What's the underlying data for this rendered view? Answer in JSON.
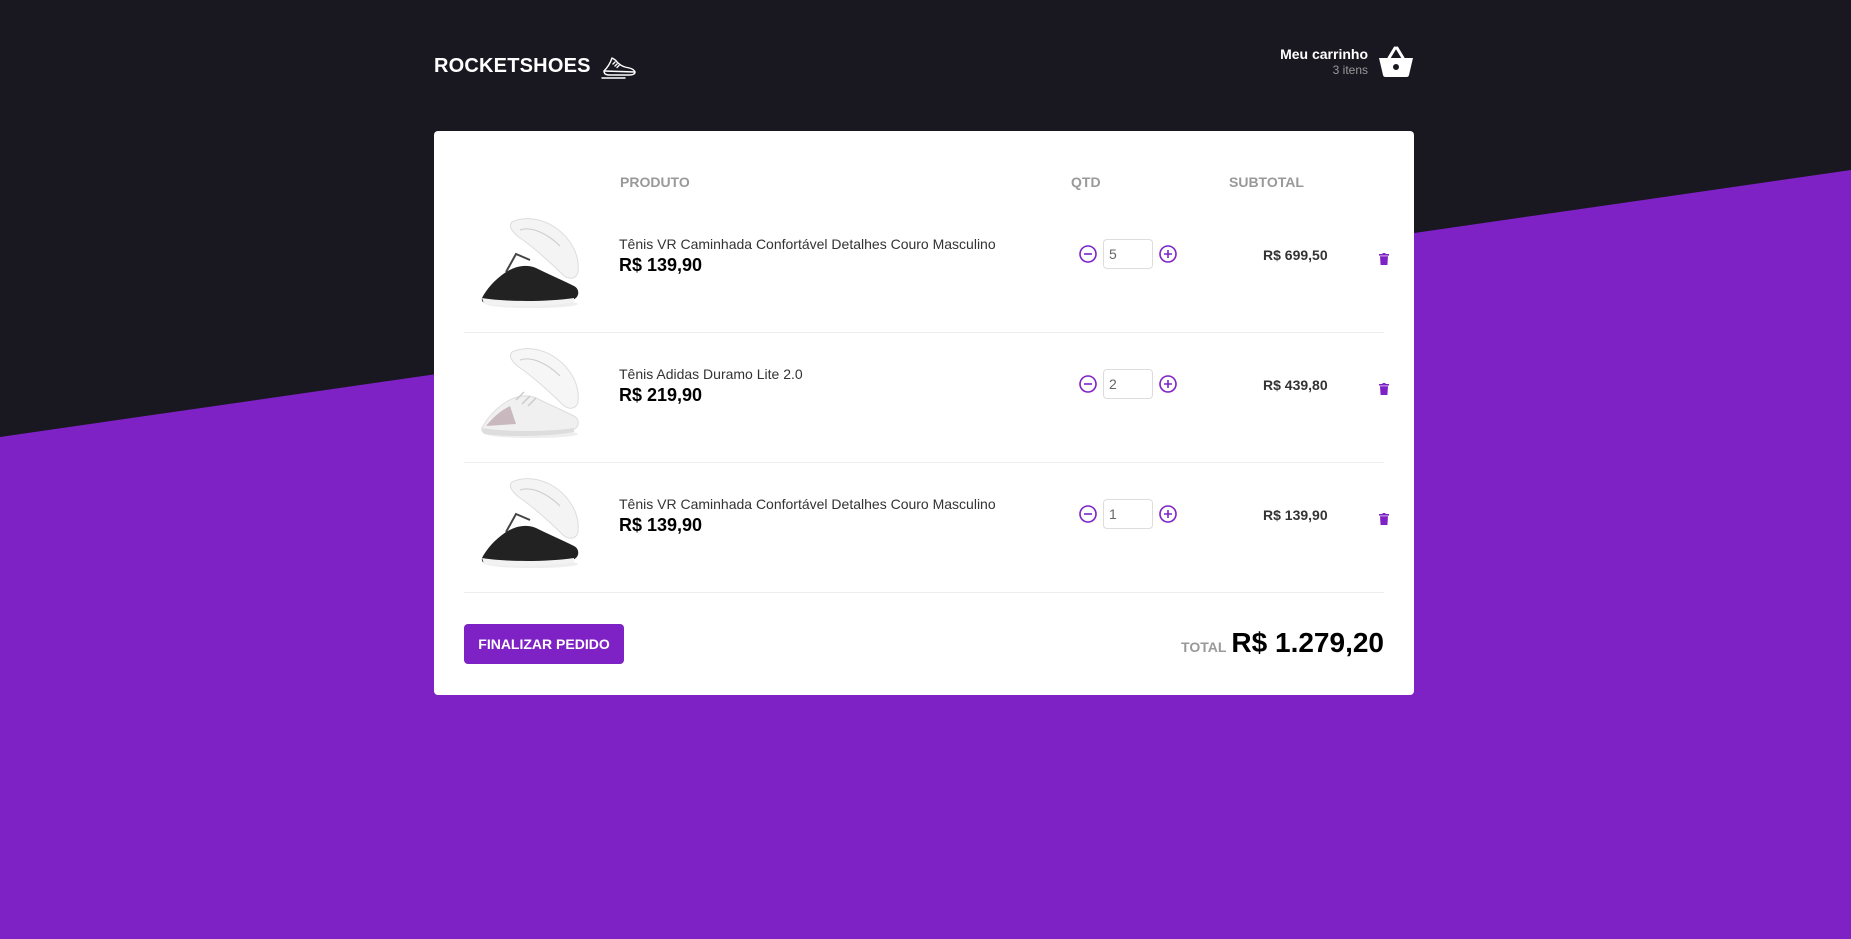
{
  "header": {
    "logo_text": "ROCKETSHOES",
    "cart_title": "Meu carrinho",
    "cart_count": "3 itens"
  },
  "table": {
    "columns": [
      "PRODUTO",
      "QTD",
      "SUBTOTAL"
    ],
    "rows": [
      {
        "title": "Tênis VR Caminhada Confortável Detalhes Couro Masculino",
        "price": "R$ 139,90",
        "amount": "5",
        "subtotal": "R$ 699,50",
        "image": "black-sneaker"
      },
      {
        "title": "Tênis Adidas Duramo Lite 2.0",
        "price": "R$ 219,90",
        "amount": "2",
        "subtotal": "R$ 439,80",
        "image": "white-sneaker"
      },
      {
        "title": "Tênis VR Caminhada Confortável Detalhes Couro Masculino",
        "price": "R$ 139,90",
        "amount": "1",
        "subtotal": "R$ 139,90",
        "image": "black-sneaker"
      }
    ]
  },
  "footer": {
    "button_label": "FINALIZAR PEDIDO",
    "total_label": "TOTAL",
    "total_value": "R$ 1.279,20"
  },
  "colors": {
    "dark_bg": "#191720",
    "accent": "#7e22c5"
  }
}
